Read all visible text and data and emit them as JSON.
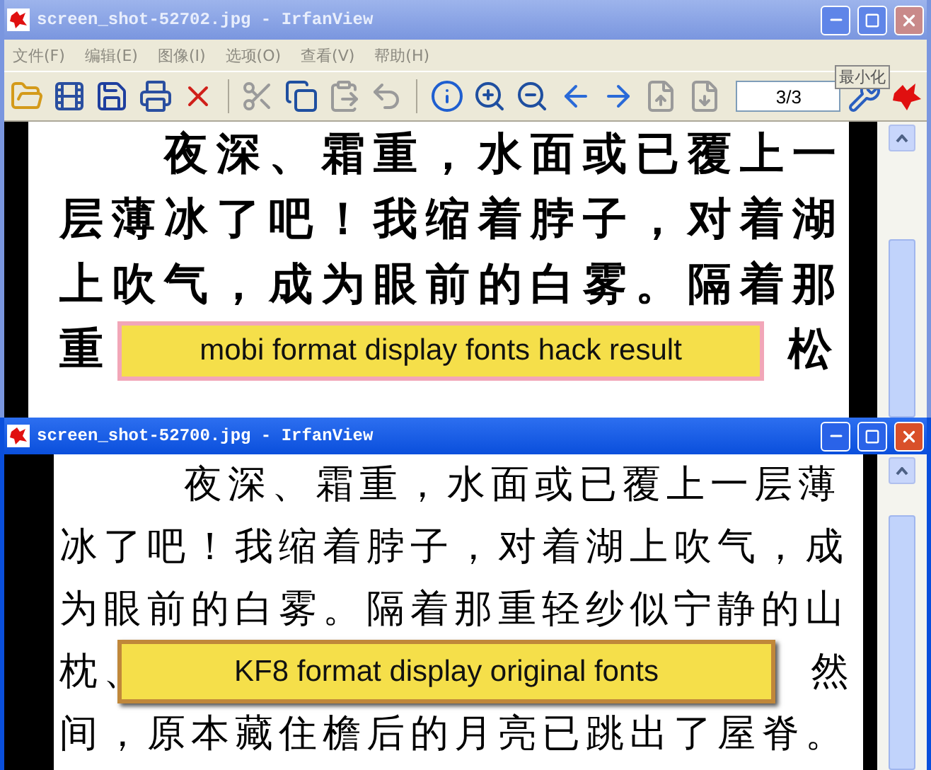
{
  "windows": [
    {
      "title": "screen_shot-52702.jpg - IrfanView",
      "active": false,
      "menu": [
        "文件(F)",
        "编辑(E)",
        "图像(I)",
        "选项(O)",
        "查看(V)",
        "帮助(H)"
      ],
      "toolbar": [
        {
          "disabled": false
        },
        {
          "disabled": false
        },
        {
          "disabled": false
        },
        {
          "disabled": false
        },
        {
          "disabled": false
        },
        {
          "disabled": true
        },
        {
          "disabled": false
        },
        {
          "disabled": true
        },
        {
          "disabled": true
        },
        {
          "disabled": false
        },
        {
          "disabled": false
        },
        {
          "disabled": false
        },
        {
          "disabled": false
        },
        {
          "disabled": false
        },
        {
          "disabled": true
        },
        {
          "disabled": true
        }
      ],
      "page_field": "3/3",
      "tooltip": "最小化",
      "document": {
        "bold": true,
        "caption": "mobi format display fonts hack result",
        "lines": [
          {
            "indented": true,
            "parts": [
              "夜深、霜重，水面或已覆上一"
            ]
          },
          {
            "indented": false,
            "parts": [
              "层薄冰了吧！我缩着脖子，对着湖"
            ]
          },
          {
            "indented": false,
            "parts": [
              "上吹气，成为眼前的白雾。隔着那"
            ]
          },
          {
            "indented": false,
            "parts": [
              "重",
              "松"
            ]
          }
        ]
      }
    },
    {
      "title": "screen_shot-52700.jpg - IrfanView",
      "active": true,
      "document": {
        "bold": false,
        "caption": "KF8 format display original fonts",
        "lines": [
          {
            "indented": true,
            "parts": [
              "夜深、霜重，水面或已覆上一层薄"
            ]
          },
          {
            "indented": false,
            "parts": [
              "冰了吧！我缩着脖子，对着湖上吹气，成"
            ]
          },
          {
            "indented": false,
            "parts": [
              "为眼前的白雾。隔着那重轻纱似宁静的山"
            ]
          },
          {
            "indented": false,
            "parts": [
              "枕、",
              "然"
            ]
          },
          {
            "indented": false,
            "parts": [
              "间，原本藏住檐后的月亮已跳出了屋脊。"
            ]
          }
        ]
      }
    }
  ]
}
